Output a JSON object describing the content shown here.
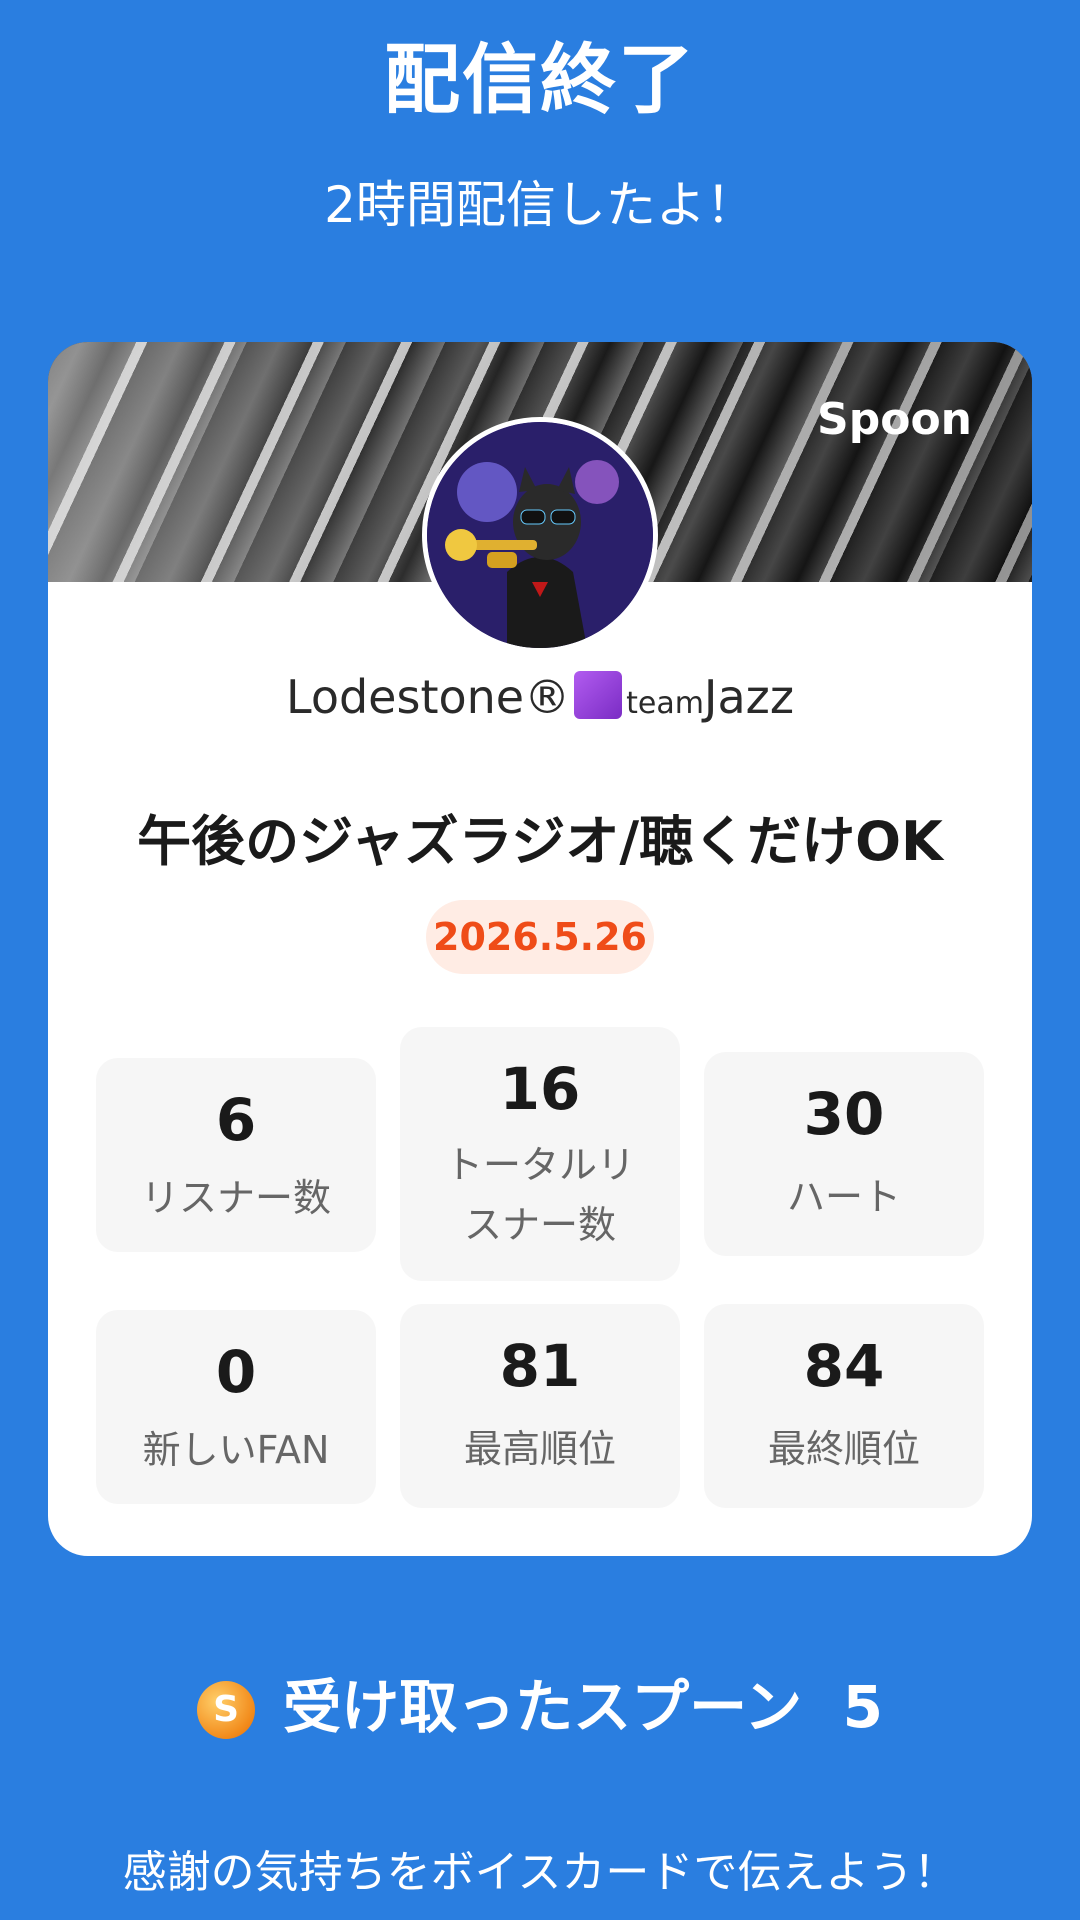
{
  "header": {
    "title": "配信終了",
    "subtitle": "2時間配信したよ！"
  },
  "card": {
    "brand": "Spoon",
    "username_prefix": "Lodestone®",
    "username_team": "team",
    "username_suffix": "Jazz",
    "live_title": "午後のジャズラジオ/聴くだけOK",
    "date": "2026.5.26",
    "stats": [
      {
        "value": "6",
        "label": "リスナー数"
      },
      {
        "value": "16",
        "label_line1": "トータルリ",
        "label_line2": "スナー数"
      },
      {
        "value": "30",
        "label": "ハート"
      },
      {
        "value": "0",
        "label": "新しいFAN"
      },
      {
        "value": "81",
        "label": "最高順位"
      },
      {
        "value": "84",
        "label": "最終順位"
      }
    ]
  },
  "spoons": {
    "coin_letter": "S",
    "label": "受け取ったスプーン",
    "count": "5"
  },
  "footer": {
    "message": "感謝の気持ちをボイスカードで伝えよう！"
  },
  "colors": {
    "background": "#2a7ee0",
    "date_accent": "#ef4c18",
    "date_badge_bg": "#ffece4"
  },
  "icons": {
    "brand_logo": "spoon-logo",
    "avatar": "cat-trumpet-avatar",
    "username_emoji": "purple-square",
    "spoon_coin": "spoon-coin-icon"
  }
}
